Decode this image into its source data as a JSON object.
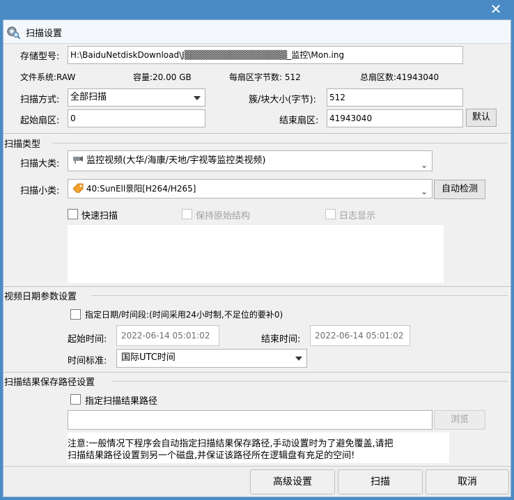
{
  "window": {
    "title": "扫描设置",
    "close_glyph": "✕"
  },
  "device": {
    "path_label": "存储型号:",
    "path_value": "H:\\BaiduNetdiskDownload\\J▒▒▒▒▒▒▒▒▒▒▒▒▒▒▒▒_监控\\Mon.ing",
    "fs_label": "文件系统:",
    "fs_value": "RAW",
    "capacity_label": "容量:",
    "capacity_value": "20.00 GB",
    "bytes_per_sector_label": "每扇区字节数:",
    "bytes_per_sector_value": "512",
    "total_sectors_label": "总扇区数:",
    "total_sectors_value": "41943040"
  },
  "scan": {
    "mode_label": "扫描方式:",
    "mode_value": "全部扫描",
    "cluster_label": "簇/块大小(字节):",
    "cluster_value": "512",
    "start_label": "起始扇区:",
    "start_value": "0",
    "end_label": "结束扇区:",
    "end_value": "41943040",
    "default_button": "默认"
  },
  "scan_type": {
    "group_title": "扫描类型",
    "category_label": "扫描大类:",
    "category_value": "监控视频(大华/海康/天地/宇视等监控类视频)",
    "subcategory_label": "扫描小类:",
    "subcategory_value": "40:SunEll景阳[H264/H265]",
    "auto_detect_button": "自动检测",
    "quick_scan": "快速扫描",
    "keep_structure": "保持原始结构",
    "log_display": "日志显示"
  },
  "date_params": {
    "group_title": "视频日期参数设置",
    "specify_range": "指定日期/时间段:(时间采用24小时制,不足位的要补0)",
    "start_time_label": "起始时间:",
    "start_time_value": "2022-06-14 05:01:02",
    "end_time_label": "结束时间:",
    "end_time_value": "2022-06-14 05:01:02",
    "time_standard_label": "时间标准:",
    "time_standard_value": "国际UTC时间"
  },
  "save_path": {
    "group_title": "扫描结果保存路径设置",
    "specify_path": "指定扫描结果路径",
    "path_value": "",
    "browse_button": "浏览",
    "note_line1": "注意:一般情况下程序会自动指定扫描结果保存路径,手动设置时为了避免覆盖,请把",
    "note_line2": "扫描结果路径设置到另一个磁盘,并保证该路径所在逻辑盘有充足的空间!"
  },
  "footer": {
    "advanced": "高级设置",
    "scan": "扫描",
    "cancel": "取消"
  },
  "icons": {
    "settings": "gear-magnifier-icon",
    "close": "close-icon",
    "category": "camera-icon",
    "subcategory": "tag-icon"
  }
}
